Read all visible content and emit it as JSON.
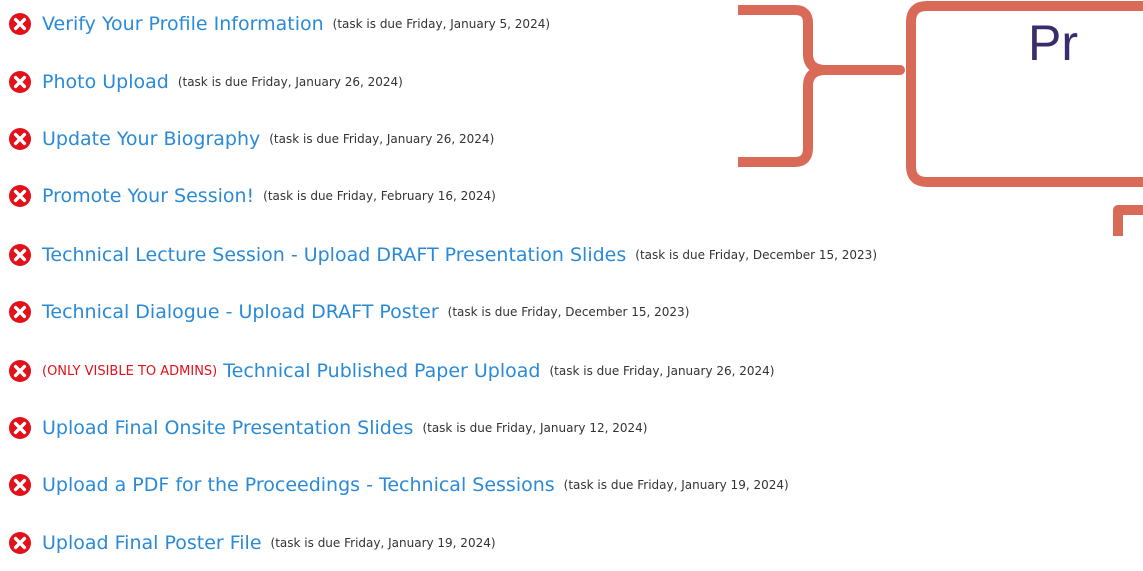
{
  "tasks": [
    {
      "label": "Verify Your Profile Information",
      "due": "(task is due Friday, January 5, 2024)",
      "admin": ""
    },
    {
      "label": "Photo Upload",
      "due": "(task is due Friday, January 26, 2024)",
      "admin": ""
    },
    {
      "label": "Update Your Biography",
      "due": "(task is due Friday, January 26, 2024)",
      "admin": ""
    },
    {
      "label": "Promote Your Session!",
      "due": "(task is due Friday, February 16, 2024)",
      "admin": ""
    },
    {
      "label": "Technical Lecture Session - Upload DRAFT Presentation Slides",
      "due": "(task is due Friday, December 15, 2023)",
      "admin": ""
    },
    {
      "label": "Technical Dialogue - Upload DRAFT Poster",
      "due": "(task is due Friday, December 15, 2023)",
      "admin": ""
    },
    {
      "label": "Technical Published Paper Upload",
      "due": "(task is due Friday, January 26, 2024)",
      "admin": "(ONLY VISIBLE TO ADMINS)"
    },
    {
      "label": "Upload Final Onsite Presentation Slides",
      "due": "(task is due Friday, January 12, 2024)",
      "admin": ""
    },
    {
      "label": "Upload a PDF for the Proceedings - Technical Sessions",
      "due": "(task is due Friday, January 19, 2024)",
      "admin": ""
    },
    {
      "label": "Upload Final Poster File",
      "due": "(task is due Friday, January 19, 2024)",
      "admin": ""
    }
  ],
  "callout": {
    "text": "Pr"
  },
  "colors": {
    "status_icon": "#e2111a",
    "link": "#2a8ad8",
    "admin_flag": "#e2111a",
    "due_note": "#333333",
    "annotation": "#d96a57",
    "callout_text": "#3b2c6b"
  },
  "icons": {
    "status": "x-circle-icon"
  }
}
